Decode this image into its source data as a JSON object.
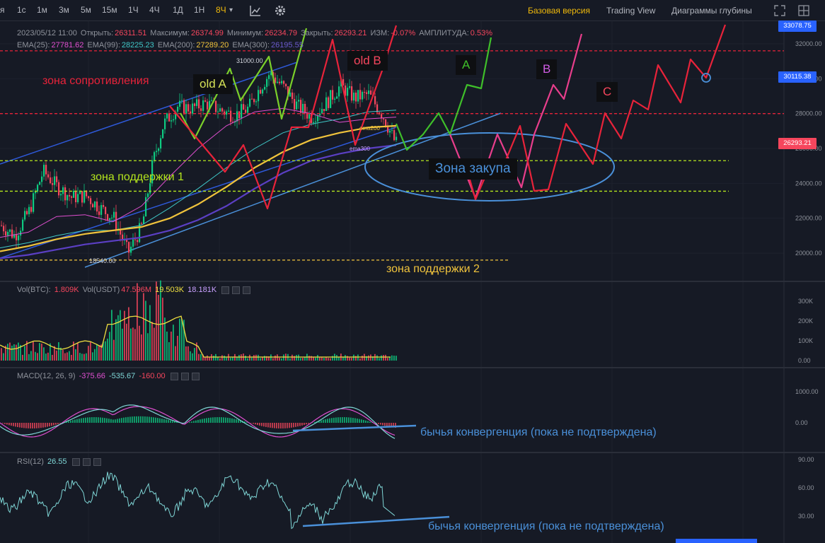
{
  "toolbar": {
    "timeframes": [
      "я",
      "1с",
      "1м",
      "3м",
      "5м",
      "15м",
      "1Ч",
      "4Ч",
      "1Д",
      "1Н",
      "8Ч"
    ],
    "active_timeframe": "8Ч",
    "dropdown_glyph": "▾",
    "icons": [
      "indicator-icon",
      "gear-icon",
      "expand-icon",
      "grid-icon"
    ],
    "menu": [
      "Базовая версия",
      "Trading View",
      "Диаграммы глубины"
    ],
    "active_menu": "Базовая версия"
  },
  "ohlc": {
    "date": "2023/05/12 11:00",
    "open_label": "Открыть:",
    "open": "26311.51",
    "high_label": "Максимум:",
    "high": "26374.99",
    "low_label": "Минимум:",
    "low": "26234.79",
    "close_label": "Закрыть:",
    "close": "26293.21",
    "change_label": "ИЗМ:",
    "change": "-0.07%",
    "amp_label": "АМПЛИТУДА:",
    "amp": "0.53%"
  },
  "ema": {
    "ema25_label": "EMA(25):",
    "ema25": "27781.62",
    "ema99_label": "EMA(99):",
    "ema99": "28225.23",
    "ema200_label": "EMA(200):",
    "ema200": "27289.20",
    "ema300_label": "EMA(300):",
    "ema300": "26195.55"
  },
  "price_badges": {
    "top": "33078.75",
    "level": "30115.38",
    "current": "26293.21"
  },
  "colors": {
    "up": "#0ecb81",
    "down": "#f6465d",
    "resistance": "#e8233a",
    "support1": "#b5e61d",
    "support2": "#f0c33c",
    "ellipse": "#4a90d9",
    "waveA": "#3fbf2a",
    "waveB": "#e83e8c",
    "waveC": "#e8233a",
    "channel": "#2e59d9"
  },
  "vol_panel": {
    "title": "Vol(BTC):",
    "btc": "1.809K",
    "usdt_label": "Vol(USDT)",
    "usdt": "47.596M",
    "ma1": "19.503K",
    "ma2": "18.181K"
  },
  "macd_panel": {
    "title": "MACD(12, 26, 9)",
    "dif": "-375.66",
    "dea": "-535.67",
    "hist": "-160.00"
  },
  "rsi_panel": {
    "title": "RSI(12)",
    "value": "26.55"
  },
  "annotations": {
    "resistance_zone": "зона сопротивления",
    "support_zone_1": "зона поддержки 1",
    "support_zone_2": "зона поддержки 2",
    "buy_zone": "Зона закупа",
    "bull_conv_macd": "бычья конвергенция (пока не подтверждена)",
    "bull_conv_rsi": "бычья конвергенция (пока не подтверждена)",
    "ema200_tag": "ema200",
    "ema300_tag": "ema300",
    "high_price": "31000.00",
    "low_price": "18540.00",
    "wave_old_a": "old A",
    "wave_old_b": "old B",
    "wave_a": "A",
    "wave_b": "B",
    "wave_c": "C"
  },
  "chart_data": {
    "type": "line",
    "main_axis": {
      "ticks": [
        32000,
        30000,
        28000,
        26000,
        24000,
        22000,
        20000
      ],
      "tick_labels": [
        "32000.00",
        "30000.00",
        "28000.00",
        "26000.00",
        "24000.00",
        "22000.00",
        "20000.00"
      ],
      "ylim": [
        19000,
        33400
      ]
    },
    "vol_axis": {
      "ticks": [
        300000,
        200000,
        100000,
        0
      ],
      "tick_labels": [
        "300K",
        "200K",
        "100K",
        "0.00"
      ]
    },
    "macd_axis": {
      "ticks": [
        1000,
        0
      ],
      "tick_labels": [
        "1000.00",
        "0.00"
      ]
    },
    "rsi_axis": {
      "ticks": [
        90,
        60,
        30
      ],
      "tick_labels": [
        "90.00",
        "60.00",
        "30.00"
      ]
    },
    "levels": {
      "resistance": 31600,
      "mid_resistance": 28000,
      "support1_top": 25300,
      "support1_bottom": 23550,
      "support2": 19600
    },
    "series": [
      {
        "name": "EMA(25)",
        "x": [
          0,
          40,
          80,
          120,
          160,
          200,
          240,
          280,
          320,
          360,
          400,
          440,
          480,
          520,
          560
        ],
        "y": [
          20900,
          21200,
          22100,
          22200,
          21800,
          22700,
          24400,
          26000,
          27300,
          28100,
          28300,
          28000,
          27500,
          27700,
          27800
        ]
      },
      {
        "name": "EMA(99)",
        "x": [
          0,
          40,
          80,
          120,
          160,
          200,
          240,
          280,
          320,
          360,
          400,
          440,
          480,
          520,
          560
        ],
        "y": [
          20300,
          20600,
          21000,
          21300,
          21300,
          21600,
          22600,
          23700,
          24900,
          26000,
          26900,
          27400,
          27700,
          28100,
          28200
        ]
      },
      {
        "name": "EMA(200)",
        "x": [
          0,
          40,
          80,
          120,
          160,
          200,
          240,
          280,
          320,
          360,
          400,
          440,
          480,
          520,
          560
        ],
        "y": [
          20100,
          20400,
          20800,
          21100,
          21300,
          21500,
          22000,
          22800,
          23800,
          24900,
          25800,
          26500,
          26900,
          27200,
          27300
        ]
      },
      {
        "name": "EMA(300)",
        "x": [
          0,
          40,
          80,
          120,
          160,
          200,
          240,
          280,
          320,
          360,
          400,
          440,
          480,
          520,
          560
        ],
        "y": [
          19700,
          19900,
          20200,
          20500,
          20700,
          20900,
          21300,
          21900,
          22700,
          23700,
          24600,
          25300,
          25700,
          26000,
          26200
        ]
      }
    ]
  }
}
